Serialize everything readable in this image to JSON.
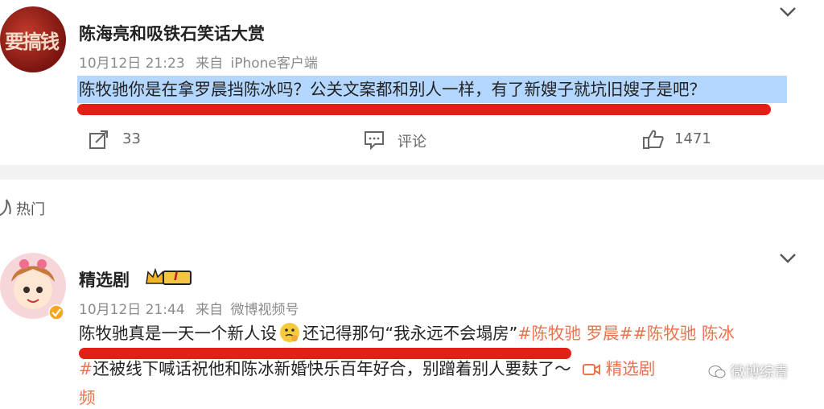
{
  "post1": {
    "author": "陈海亮和吸铁石笑话大赏",
    "avatar_text": "要搞钱",
    "date": "10月12日 21:23",
    "source_prefix": "来自",
    "source": "iPhone客户端",
    "text": "陈牧驰你是在拿罗晨挡陈冰吗？公关文案都和别人一样，有了新嫂子就坑旧嫂子是吧？",
    "repost_count": "33",
    "comment_label": "评论",
    "like_count": "1471"
  },
  "section": {
    "label": "热门"
  },
  "post2": {
    "author": "精选剧",
    "badge_text": "I",
    "date": "10月12日 21:44",
    "source_prefix": "来自",
    "source": "微博视频号",
    "line1_pre": "陈牧驰真是一天一个新人设",
    "line1_mid": "还记得那句“我永远不会塌房”",
    "line1_tags": "#陈牧驰 罗晨##陈牧驰 陈冰",
    "line2_tag": "#",
    "line2_text": "还被线下喊话祝他和陈冰新婚快乐百年好合，别蹭着别人要麸了～",
    "video_label": "精选剧",
    "line3": "频"
  },
  "watermark": "微博综青",
  "colors": {
    "accent": "#eb7350",
    "highlight": "#b4d7ff",
    "underline": "#e32018"
  }
}
